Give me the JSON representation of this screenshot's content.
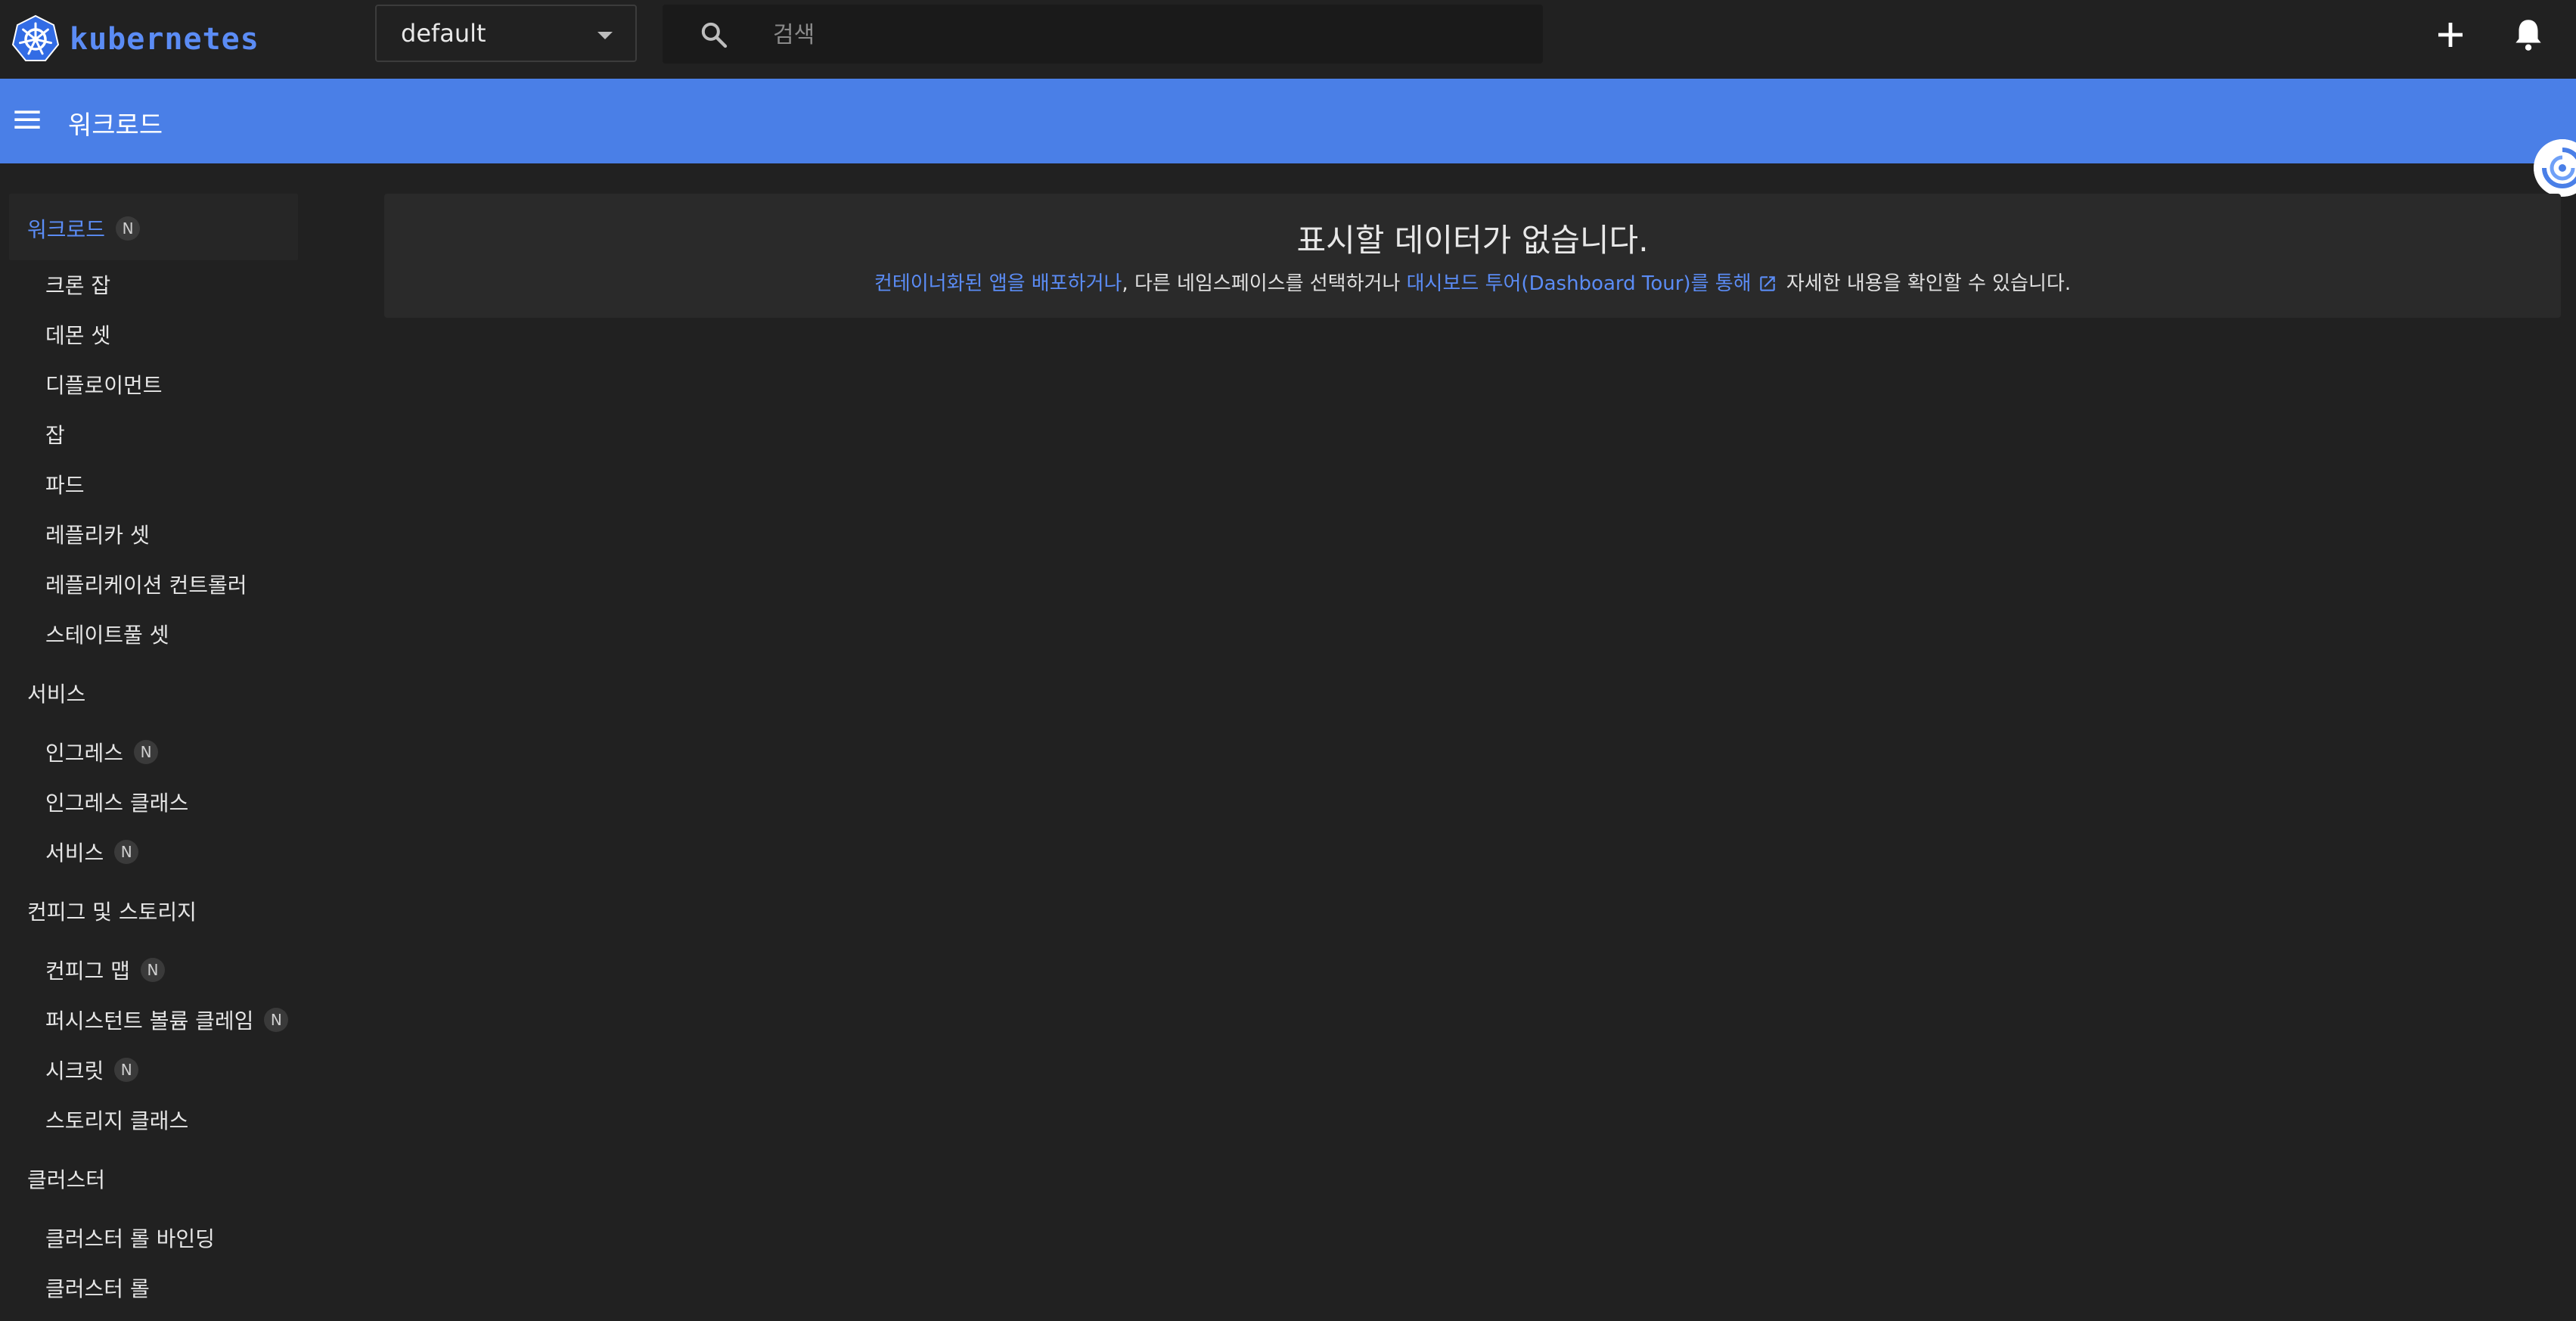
{
  "app": {
    "logo_text": "kubernetes"
  },
  "topbar": {
    "namespace_value": "default",
    "search_placeholder": "검색"
  },
  "header": {
    "title": "워크로드"
  },
  "sidebar": {
    "workloads": {
      "label": "워크로드",
      "badge": "N"
    },
    "workload_items": [
      {
        "label": "크론 잡"
      },
      {
        "label": "데몬 셋"
      },
      {
        "label": "디플로이먼트"
      },
      {
        "label": "잡"
      },
      {
        "label": "파드"
      },
      {
        "label": "레플리카 셋"
      },
      {
        "label": "레플리케이션 컨트롤러"
      },
      {
        "label": "스테이트풀 셋"
      }
    ],
    "services": {
      "label": "서비스"
    },
    "service_items": [
      {
        "label": "인그레스",
        "badge": "N"
      },
      {
        "label": "인그레스 클래스"
      },
      {
        "label": "서비스",
        "badge": "N"
      }
    ],
    "config": {
      "label": "컨피그 및 스토리지"
    },
    "config_items": [
      {
        "label": "컨피그 맵",
        "badge": "N"
      },
      {
        "label": "퍼시스턴트 볼륨 클레임",
        "badge": "N"
      },
      {
        "label": "시크릿",
        "badge": "N"
      },
      {
        "label": "스토리지 클래스"
      }
    ],
    "cluster": {
      "label": "클러스터"
    },
    "cluster_items": [
      {
        "label": "클러스터 롤 바인딩"
      },
      {
        "label": "클러스터 롤"
      }
    ]
  },
  "main": {
    "empty_title": "표시할 데이터가 없습니다.",
    "link_deploy": "컨테이너화된 앱을 배포하거나",
    "text_middle": ", 다른 네임스페이스를 선택하거나 ",
    "link_tour": "대시보드 투어(Dashboard Tour)를 통해",
    "text_end": " 자세한 내용을 확인할 수 있습니다."
  },
  "colors": {
    "background": "#212121",
    "accent": "#4a7fe7",
    "link": "#5b8cf5",
    "card": "#2a2a2a"
  },
  "icons": [
    "kubernetes-logo-icon",
    "search-icon",
    "add-icon",
    "bell-icon",
    "menu-icon",
    "external-link-icon",
    "helper-orb-icon"
  ]
}
